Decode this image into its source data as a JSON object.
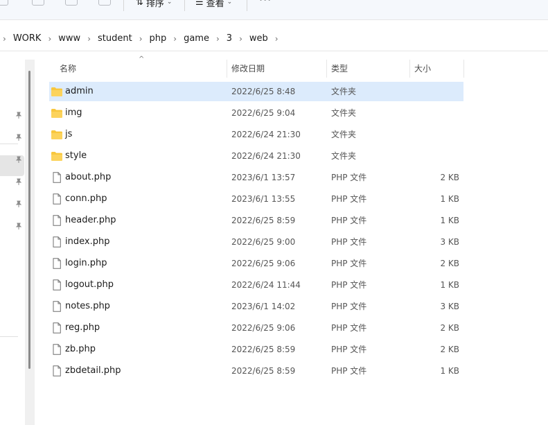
{
  "toolbar": {
    "sort_label": "排序",
    "view_label": "查看",
    "more_label": "···"
  },
  "breadcrumb": [
    "WORK",
    "www",
    "student",
    "php",
    "game",
    "3",
    "web"
  ],
  "columns": {
    "name": "名称",
    "date": "修改日期",
    "type": "类型",
    "size": "大小"
  },
  "files": [
    {
      "name": "admin",
      "date": "2022/6/25 8:48",
      "type": "文件夹",
      "size": "",
      "kind": "folder",
      "selected": true
    },
    {
      "name": "img",
      "date": "2022/6/25 9:04",
      "type": "文件夹",
      "size": "",
      "kind": "folder"
    },
    {
      "name": "js",
      "date": "2022/6/24 21:30",
      "type": "文件夹",
      "size": "",
      "kind": "folder"
    },
    {
      "name": "style",
      "date": "2022/6/24 21:30",
      "type": "文件夹",
      "size": "",
      "kind": "folder"
    },
    {
      "name": "about.php",
      "date": "2023/6/1 13:57",
      "type": "PHP 文件",
      "size": "2 KB",
      "kind": "file"
    },
    {
      "name": "conn.php",
      "date": "2023/6/1 13:55",
      "type": "PHP 文件",
      "size": "1 KB",
      "kind": "file"
    },
    {
      "name": "header.php",
      "date": "2022/6/25 8:59",
      "type": "PHP 文件",
      "size": "1 KB",
      "kind": "file"
    },
    {
      "name": "index.php",
      "date": "2022/6/25 9:00",
      "type": "PHP 文件",
      "size": "3 KB",
      "kind": "file"
    },
    {
      "name": "login.php",
      "date": "2022/6/25 9:06",
      "type": "PHP 文件",
      "size": "2 KB",
      "kind": "file"
    },
    {
      "name": "logout.php",
      "date": "2022/6/24 11:44",
      "type": "PHP 文件",
      "size": "1 KB",
      "kind": "file"
    },
    {
      "name": "notes.php",
      "date": "2023/6/1 14:02",
      "type": "PHP 文件",
      "size": "3 KB",
      "kind": "file"
    },
    {
      "name": "reg.php",
      "date": "2022/6/25 9:06",
      "type": "PHP 文件",
      "size": "2 KB",
      "kind": "file"
    },
    {
      "name": "zb.php",
      "date": "2022/6/25 8:59",
      "type": "PHP 文件",
      "size": "2 KB",
      "kind": "file"
    },
    {
      "name": "zbdetail.php",
      "date": "2022/6/25 8:59",
      "type": "PHP 文件",
      "size": "1 KB",
      "kind": "file"
    }
  ],
  "colors": {
    "selection": "#dcebfc",
    "folder": "#f8c73e"
  }
}
